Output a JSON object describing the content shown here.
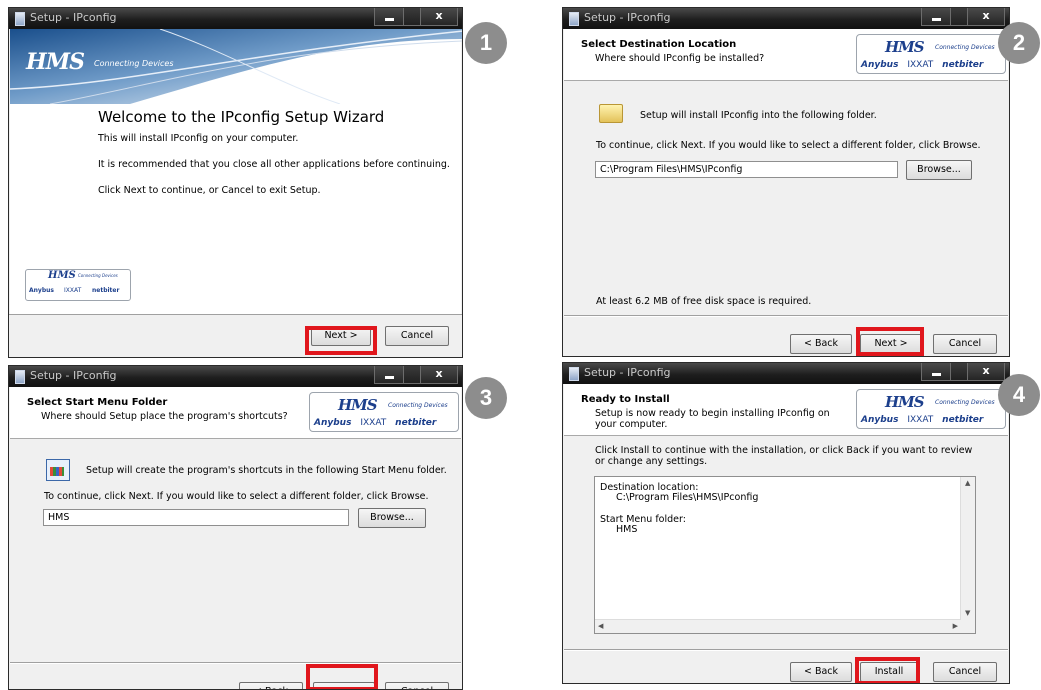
{
  "window_title": "Setup - IPconfig",
  "badges": [
    "1",
    "2",
    "3",
    "4"
  ],
  "logo": {
    "brand": "HMS",
    "tagline": "Connecting Devices",
    "anybus": "Anybus",
    "ixxat": "IXXAT",
    "netbiter": "netbiter"
  },
  "buttons": {
    "next": "Next >",
    "back": "< Back",
    "cancel": "Cancel",
    "browse": "Browse...",
    "install": "Install"
  },
  "step1": {
    "heading": "Welcome to the IPconfig Setup Wizard",
    "line1": "This will install IPconfig on your computer.",
    "line2": "It is recommended that you close all other applications before continuing.",
    "line3": "Click Next to continue, or Cancel to exit Setup."
  },
  "step2": {
    "title": "Select Destination Location",
    "subtitle": "Where should IPconfig be installed?",
    "info": "Setup will install IPconfig into the following folder.",
    "instruction": "To continue, click Next. If you would like to select a different folder, click Browse.",
    "path": "C:\\Program Files\\HMS\\IPconfig",
    "disk_space": "At least 6.2 MB of free disk space is required."
  },
  "step3": {
    "title": "Select Start Menu Folder",
    "subtitle": "Where should Setup place the program's shortcuts?",
    "info": "Setup will create the program's shortcuts in the following Start Menu folder.",
    "instruction": "To continue, click Next. If you would like to select a different folder, click Browse.",
    "folder": "HMS"
  },
  "step4": {
    "title": "Ready to Install",
    "subtitle": "Setup is now ready to begin installing IPconfig on your computer.",
    "instruction": "Click Install to continue with the installation, or click Back if you want to review or change any settings.",
    "dest_label": "Destination location:",
    "dest_value": "C:\\Program Files\\HMS\\IPconfig",
    "menu_label": "Start Menu folder:",
    "menu_value": "HMS"
  },
  "colors": {
    "highlight": "#e0161c",
    "badge": "#8d8d8d",
    "brand": "#1c3f8c"
  }
}
